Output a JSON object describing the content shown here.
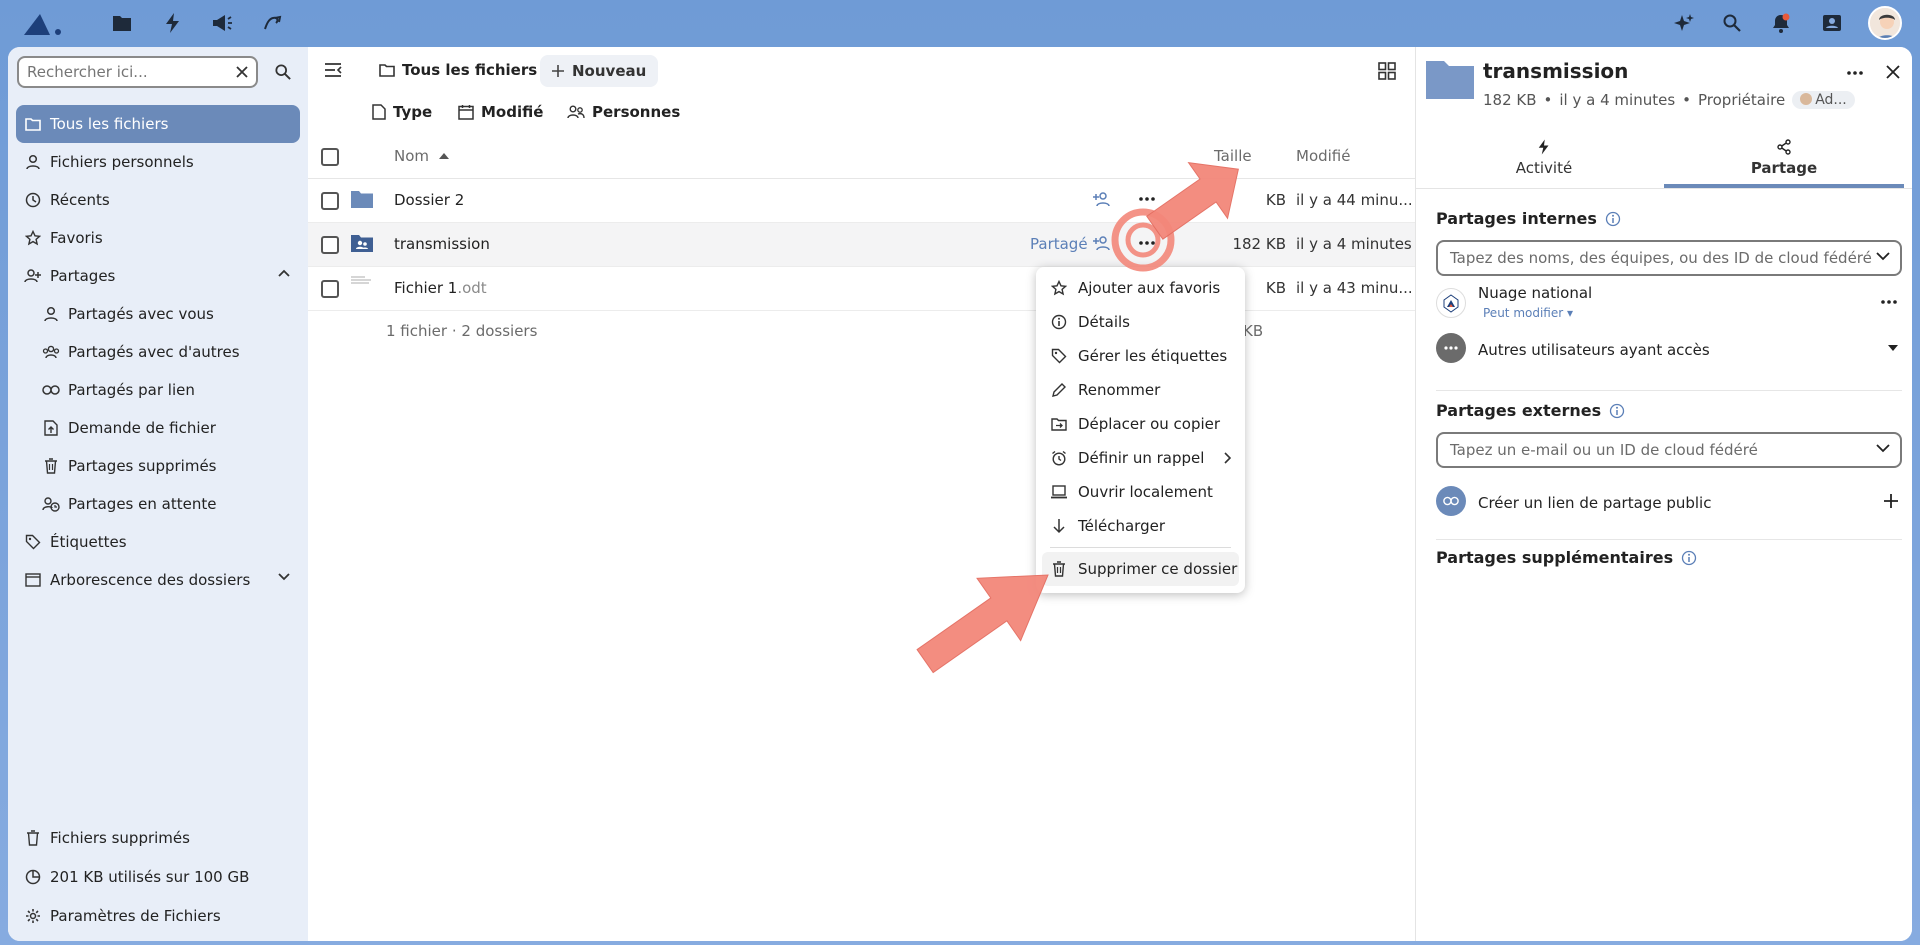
{
  "topbar": {
    "apps": [
      "files-icon",
      "activity-icon",
      "announcements-icon",
      "custom-app-icon"
    ],
    "right_icons": [
      "assistant-icon",
      "search-icon",
      "notifications-icon",
      "contacts-icon"
    ],
    "notification_color": "#e8593a"
  },
  "sidebar": {
    "search_placeholder": "Rechercher ici...",
    "items": [
      {
        "label": "Tous les fichiers",
        "icon": "folder-icon",
        "active": true
      },
      {
        "label": "Fichiers personnels",
        "icon": "person-icon"
      },
      {
        "label": "Récents",
        "icon": "clock-icon"
      },
      {
        "label": "Favoris",
        "icon": "star-icon"
      },
      {
        "label": "Partages",
        "icon": "share-people-icon",
        "expanded": true
      },
      {
        "label": "Partagés avec vous",
        "icon": "person-icon",
        "sub": true
      },
      {
        "label": "Partagés avec d'autres",
        "icon": "group-icon",
        "sub": true
      },
      {
        "label": "Partagés par lien",
        "icon": "link-icon",
        "sub": true
      },
      {
        "label": "Demande de fichier",
        "icon": "file-upload-icon",
        "sub": true
      },
      {
        "label": "Partages supprimés",
        "icon": "trash-icon",
        "sub": true
      },
      {
        "label": "Partages en attente",
        "icon": "pending-icon",
        "sub": true
      },
      {
        "label": "Étiquettes",
        "icon": "tag-icon"
      },
      {
        "label": "Arborescence des dossiers",
        "icon": "folder-tree-icon"
      }
    ],
    "bottom": {
      "trash": "Fichiers supprimés",
      "quota": "201 KB utilisés sur 100 GB",
      "settings": "Paramètres de Fichiers"
    }
  },
  "main": {
    "breadcrumb": "Tous les fichiers",
    "new_label": "Nouveau",
    "filters": {
      "type": "Type",
      "modified": "Modifié",
      "people": "Personnes"
    },
    "columns": {
      "name": "Nom",
      "size": "Taille",
      "modified": "Modifié"
    },
    "rows": [
      {
        "name": "Dossier 2",
        "ext": "",
        "size": "KB",
        "modified": "il y a 44 minu..."
      },
      {
        "name": "transmission",
        "ext": "",
        "size": "182 KB",
        "modified": "il y a 4 minutes",
        "shared_label": "Partagé"
      },
      {
        "name": "Fichier 1",
        "ext": ".odt",
        "size": "KB",
        "modified": "il y a 43 minu..."
      }
    ],
    "summary": "1 fichier · 2 dossiers",
    "summary_size": "KB"
  },
  "menu": {
    "items": [
      {
        "label": "Ajouter aux favoris",
        "icon": "star-icon"
      },
      {
        "label": "Détails",
        "icon": "info-icon"
      },
      {
        "label": "Gérer les étiquettes",
        "icon": "tag-icon"
      },
      {
        "label": "Renommer",
        "icon": "pencil-icon"
      },
      {
        "label": "Déplacer ou copier",
        "icon": "folder-move-icon"
      },
      {
        "label": "Définir un rappel",
        "icon": "alarm-icon"
      },
      {
        "label": "Ouvrir localement",
        "icon": "laptop-icon"
      },
      {
        "label": "Télécharger",
        "icon": "download-icon"
      }
    ],
    "delete": "Supprimer ce dossier"
  },
  "details": {
    "title": "transmission",
    "size": "182 KB",
    "time": "il y a 4 minutes",
    "owner_label": "Propriétaire",
    "owner_chip": "Ad...",
    "tabs": {
      "activity": "Activité",
      "sharing": "Partage"
    },
    "internal": {
      "title": "Partages internes",
      "placeholder": "Tapez des noms, des équipes, ou des ID de cloud fédéré",
      "user_name": "Nuage national",
      "user_perm": "Peut modifier",
      "others": "Autres utilisateurs ayant accès"
    },
    "external": {
      "title": "Partages externes",
      "placeholder": "Tapez un e-mail ou un ID de cloud fédéré",
      "public_link": "Créer un lien de partage public"
    },
    "additional": "Partages supplémentaires"
  },
  "colors": {
    "accent": "#6b8ab9",
    "annotation": "#f3877a"
  }
}
